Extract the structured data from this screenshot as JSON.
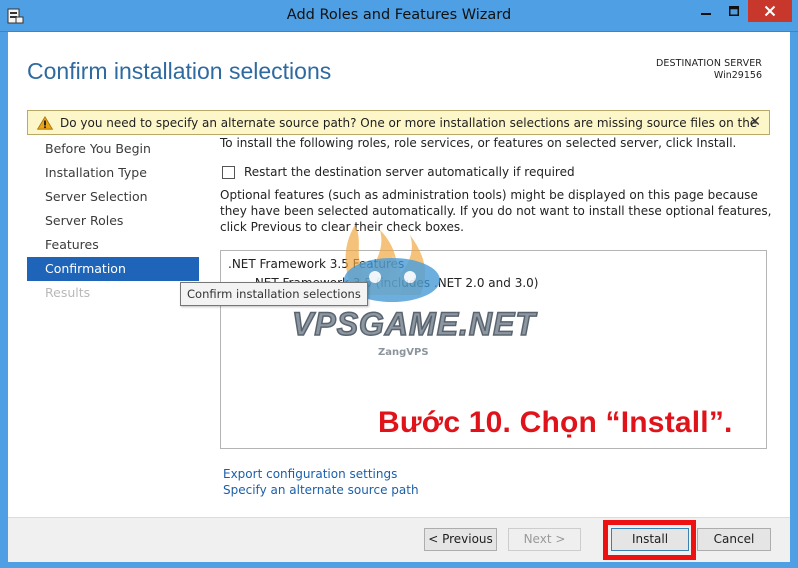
{
  "window": {
    "title": "Add Roles and Features Wizard",
    "accent_color": "#4e9fe3",
    "close_color": "#c7372b"
  },
  "header": {
    "page_title": "Confirm installation selections",
    "destination_label": "DESTINATION SERVER",
    "destination_name": "Win29156"
  },
  "warning": {
    "icon": "warning-triangle-icon",
    "text": "Do you need to specify an alternate source path? One or more installation selections are missing source files on the destinati...",
    "close_glyph": "✕"
  },
  "sidebar": {
    "items": [
      {
        "label": "Before You Begin",
        "state": "normal"
      },
      {
        "label": "Installation Type",
        "state": "normal"
      },
      {
        "label": "Server Selection",
        "state": "normal"
      },
      {
        "label": "Server Roles",
        "state": "normal"
      },
      {
        "label": "Features",
        "state": "normal"
      },
      {
        "label": "Confirmation",
        "state": "active"
      },
      {
        "label": "Results",
        "state": "disabled"
      }
    ],
    "active_color": "#1e64b8"
  },
  "tooltip": {
    "text": "Confirm installation selections"
  },
  "main": {
    "intro": "To install the following roles, role services, or features on selected server, click Install.",
    "restart_checkbox": {
      "label": "Restart the destination server automatically if required",
      "checked": false
    },
    "optional_text": "Optional features (such as administration tools) might be displayed on this page because they have been selected automatically. If you do not want to install these optional features, click Previous to clear their check boxes.",
    "features": [
      ".NET Framework 3.5 Features",
      ".NET Framework 3.5 (includes .NET 2.0 and 3.0)"
    ],
    "annotation": "Bước 10. Chọn “Install”.",
    "links": {
      "export": "Export configuration settings",
      "alternate": "Specify an alternate source path"
    }
  },
  "watermark": {
    "text": "VPSGAME.NET",
    "sub": "ZangVPS"
  },
  "footer": {
    "previous_label": "< Previous",
    "next_label": "Next >",
    "install_label": "Install",
    "cancel_label": "Cancel",
    "highlight_color": "#ee1111"
  }
}
